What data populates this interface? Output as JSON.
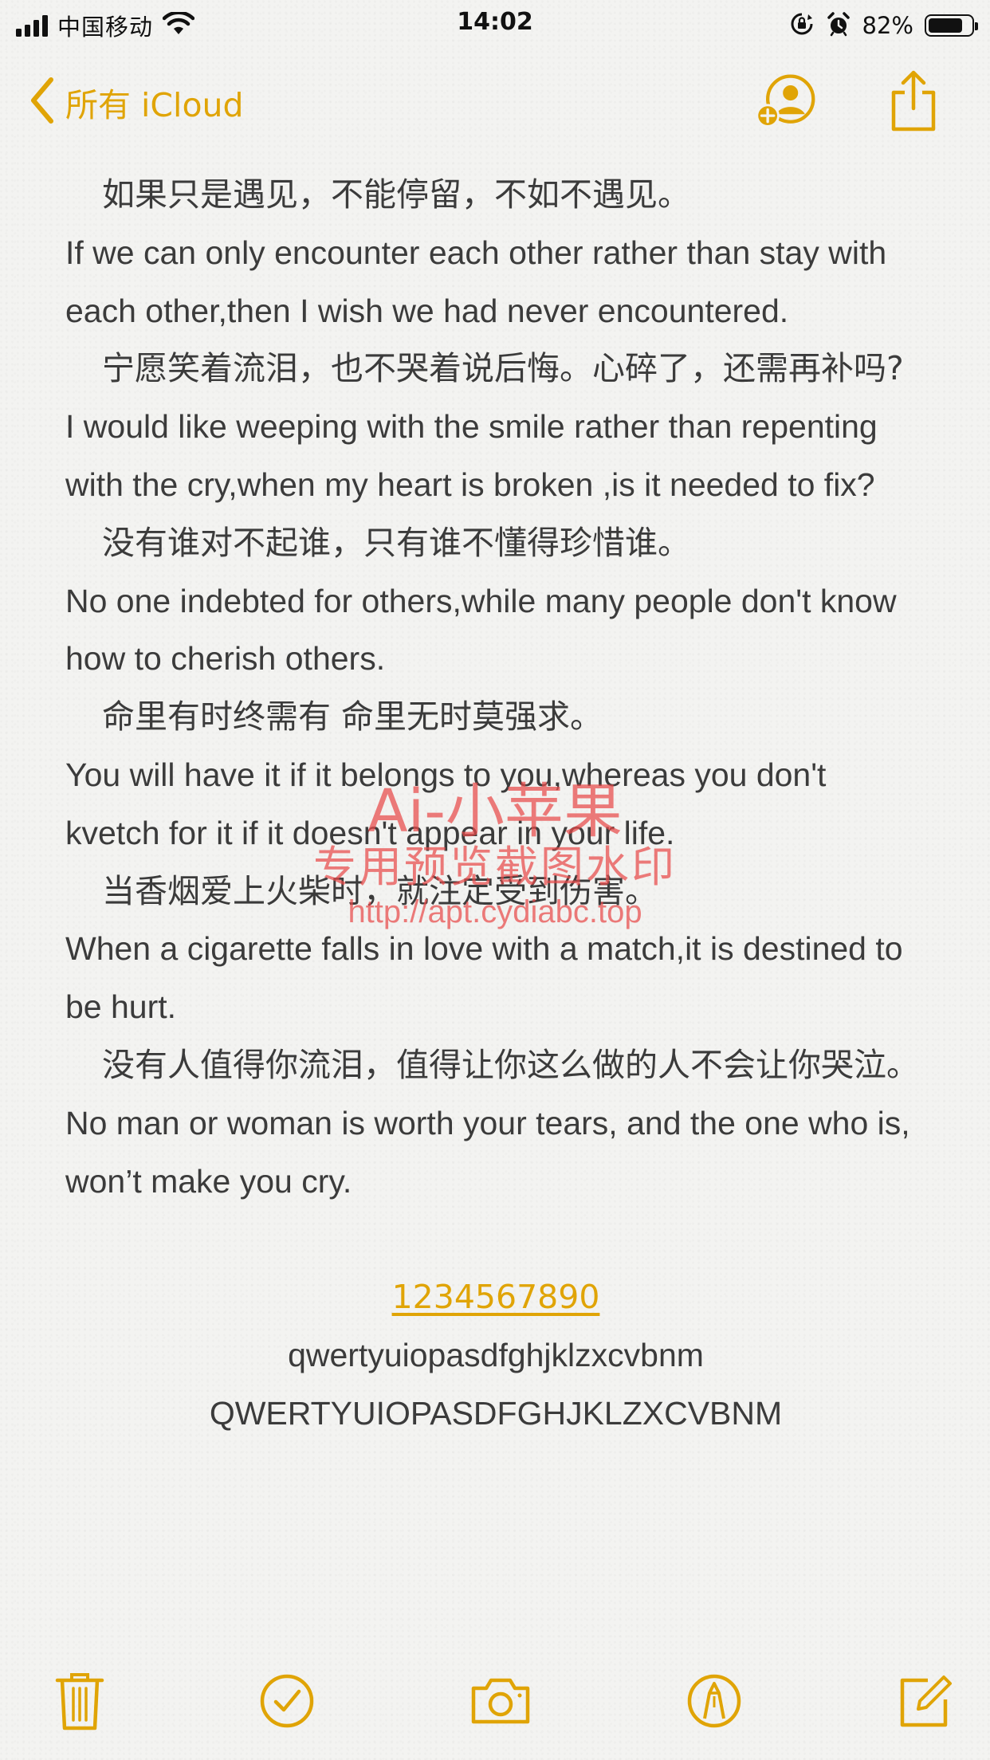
{
  "status_bar": {
    "carrier": "中国移动",
    "time": "14:02",
    "battery_percent": "82%",
    "battery_level": 0.82,
    "icons": [
      "signal-icon",
      "wifi-icon",
      "orientation-lock-icon",
      "alarm-icon",
      "battery-icon"
    ]
  },
  "nav": {
    "back_label": "所有 iCloud",
    "actions": [
      "add-person-icon",
      "share-icon"
    ]
  },
  "note": {
    "lines": [
      {
        "type": "zh",
        "text": "如果只是遇见，不能停留，不如不遇见。"
      },
      {
        "type": "en",
        "text": "If we can only encounter each other rather than stay with each other,then I wish we had never encountered."
      },
      {
        "type": "zh",
        "text": "宁愿笑着流泪，也不哭着说后悔。心碎了，还需再补吗?"
      },
      {
        "type": "en",
        "text": "I would like weeping with the smile rather than repenting with the cry,when my heart is broken ,is it needed to fix?"
      },
      {
        "type": "zh",
        "text": "没有谁对不起谁，只有谁不懂得珍惜谁。"
      },
      {
        "type": "en",
        "text": "No one indebted for others,while many people don't know how to cherish others."
      },
      {
        "type": "zh",
        "text": "命里有时终需有 命里无时莫强求。"
      },
      {
        "type": "en",
        "text": "You will have it if it belongs to you,whereas you don't kvetch for it if it doesn't appear in your life."
      },
      {
        "type": "zh",
        "text": "当香烟爱上火柴时，就注定受到伤害。"
      },
      {
        "type": "en",
        "text": "When a cigarette falls in love with a match,it is destined to be hurt."
      },
      {
        "type": "zh",
        "text": "没有人值得你流泪，值得让你这么做的人不会让你哭泣。"
      },
      {
        "type": "en",
        "text": "No man or woman is worth your tears, and the one who is, won’t make you cry."
      }
    ],
    "digits_link": "1234567890",
    "lowercase": "qwertyuiopasdfghjklzxcvbnm",
    "uppercase": "QWERTYUIOPASDFGHJKLZXCVBNM"
  },
  "watermark": {
    "line1": "Ai-小苹果",
    "line2": "专用预览截图水印",
    "line3": "http://apt.cydiabc.top"
  },
  "toolbar": {
    "items": [
      "trash-icon",
      "checklist-icon",
      "camera-icon",
      "markup-icon",
      "compose-icon"
    ]
  },
  "colors": {
    "accent": "#e0a406",
    "text": "#3b3b3b",
    "background": "#f3f3f1",
    "watermark": "#e84a4a"
  }
}
